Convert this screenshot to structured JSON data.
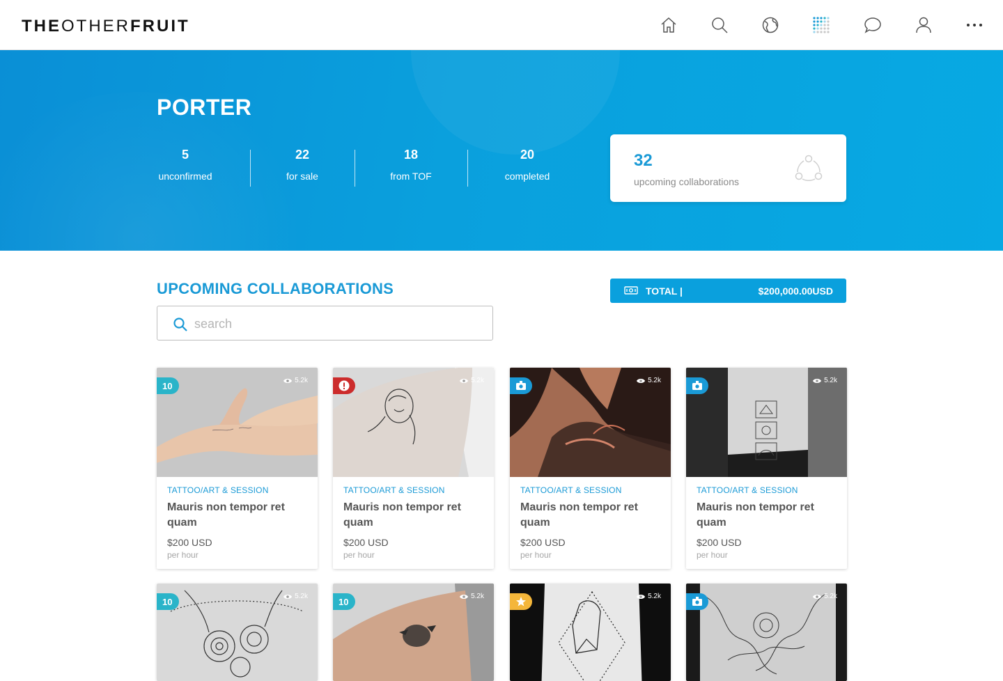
{
  "brand": {
    "logo_bold_1": "THE",
    "logo_light": "OTHER",
    "logo_bold_2": "FRUIT"
  },
  "nav": [
    {
      "name": "home-icon"
    },
    {
      "name": "search-icon"
    },
    {
      "name": "globe-icon"
    },
    {
      "name": "dots-grid-icon"
    },
    {
      "name": "chat-icon"
    },
    {
      "name": "user-icon"
    },
    {
      "name": "more-icon"
    }
  ],
  "hero": {
    "title": "PORTER",
    "stats": [
      {
        "value": "5",
        "label": "unconfirmed"
      },
      {
        "value": "22",
        "label": "for sale"
      },
      {
        "value": "18",
        "label": "from TOF"
      },
      {
        "value": "20",
        "label": "completed"
      }
    ],
    "collab_card": {
      "value": "32",
      "label": "upcoming collaborations"
    }
  },
  "section": {
    "title": "UPCOMING COLLABORATIONS",
    "total_label": "TOTAL |",
    "total_amount": "$200,000.00USD",
    "search_placeholder": "search"
  },
  "colors": {
    "accent": "#1a9ad6",
    "hero": "#0aa0dd",
    "teal": "#2ab4c9",
    "alert": "#cc2c2c",
    "star": "#f4b63a"
  },
  "cards": [
    {
      "badge": "10",
      "badge_type": "teal",
      "views": "5.2k",
      "category": "TATTOO/ART & SESSION",
      "title": "Mauris non tempor ret quam",
      "price": "$200 USD",
      "unit": "per hour"
    },
    {
      "badge": "!",
      "badge_type": "red",
      "views": "5.2k",
      "category": "TATTOO/ART & SESSION",
      "title": "Mauris non tempor ret quam",
      "price": "$200 USD",
      "unit": "per hour"
    },
    {
      "badge": "",
      "badge_type": "blue",
      "views": "5.2k",
      "category": "TATTOO/ART & SESSION",
      "title": "Mauris non tempor ret quam",
      "price": "$200 USD",
      "unit": "per hour"
    },
    {
      "badge": "",
      "badge_type": "blue",
      "views": "5.2k",
      "category": "TATTOO/ART & SESSION",
      "title": "Mauris non tempor ret quam",
      "price": "$200 USD",
      "unit": "per hour"
    },
    {
      "badge": "10",
      "badge_type": "teal",
      "views": "5.2k"
    },
    {
      "badge": "10",
      "badge_type": "teal",
      "views": "5.2k"
    },
    {
      "badge": "",
      "badge_type": "gold",
      "views": "5.2k"
    },
    {
      "badge": "",
      "badge_type": "blue",
      "views": "5.2k"
    }
  ]
}
